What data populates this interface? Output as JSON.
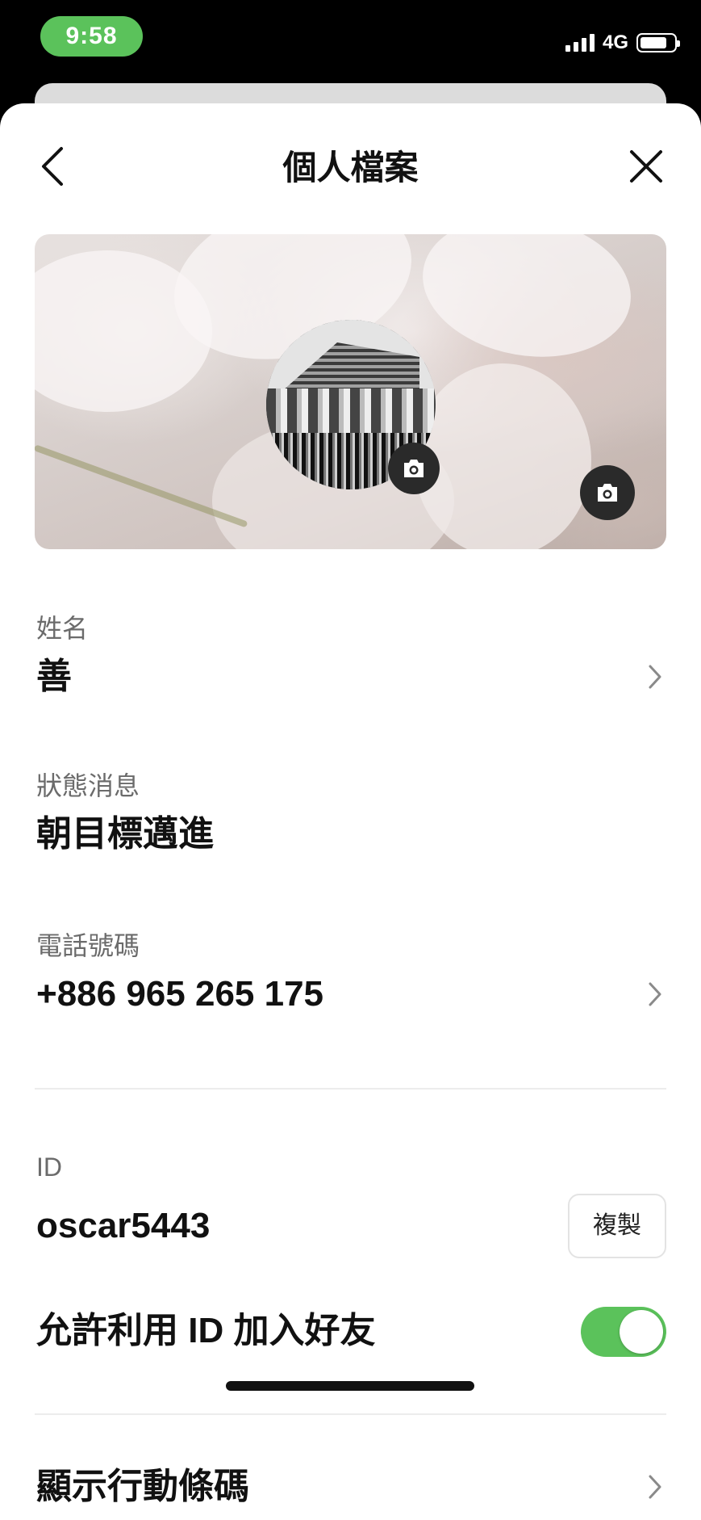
{
  "status_bar": {
    "time": "9:58",
    "network": "4G",
    "battery_level": 0.8,
    "signal_bars": 4
  },
  "header": {
    "title": "個人檔案",
    "back_icon": "chevron-left-icon",
    "close_icon": "close-icon"
  },
  "profile": {
    "avatar_camera_icon": "camera-icon",
    "cover_camera_icon": "camera-icon"
  },
  "fields": {
    "name": {
      "label": "姓名",
      "value": "善"
    },
    "status": {
      "label": "狀態消息",
      "value": "朝目標邁進"
    },
    "phone": {
      "label": "電話號碼",
      "value": "+886 965 265 175"
    },
    "id": {
      "label": "ID",
      "value": "oscar5443",
      "copy_label": "複製"
    }
  },
  "settings": {
    "allow_add_by_id": {
      "label": "允許利用 ID 加入好友",
      "enabled": true
    },
    "show_barcode": {
      "label": "顯示行動條碼"
    }
  },
  "colors": {
    "accent_green": "#5bc25b",
    "label_gray": "#6b6b6b",
    "text_dark": "#111111"
  }
}
